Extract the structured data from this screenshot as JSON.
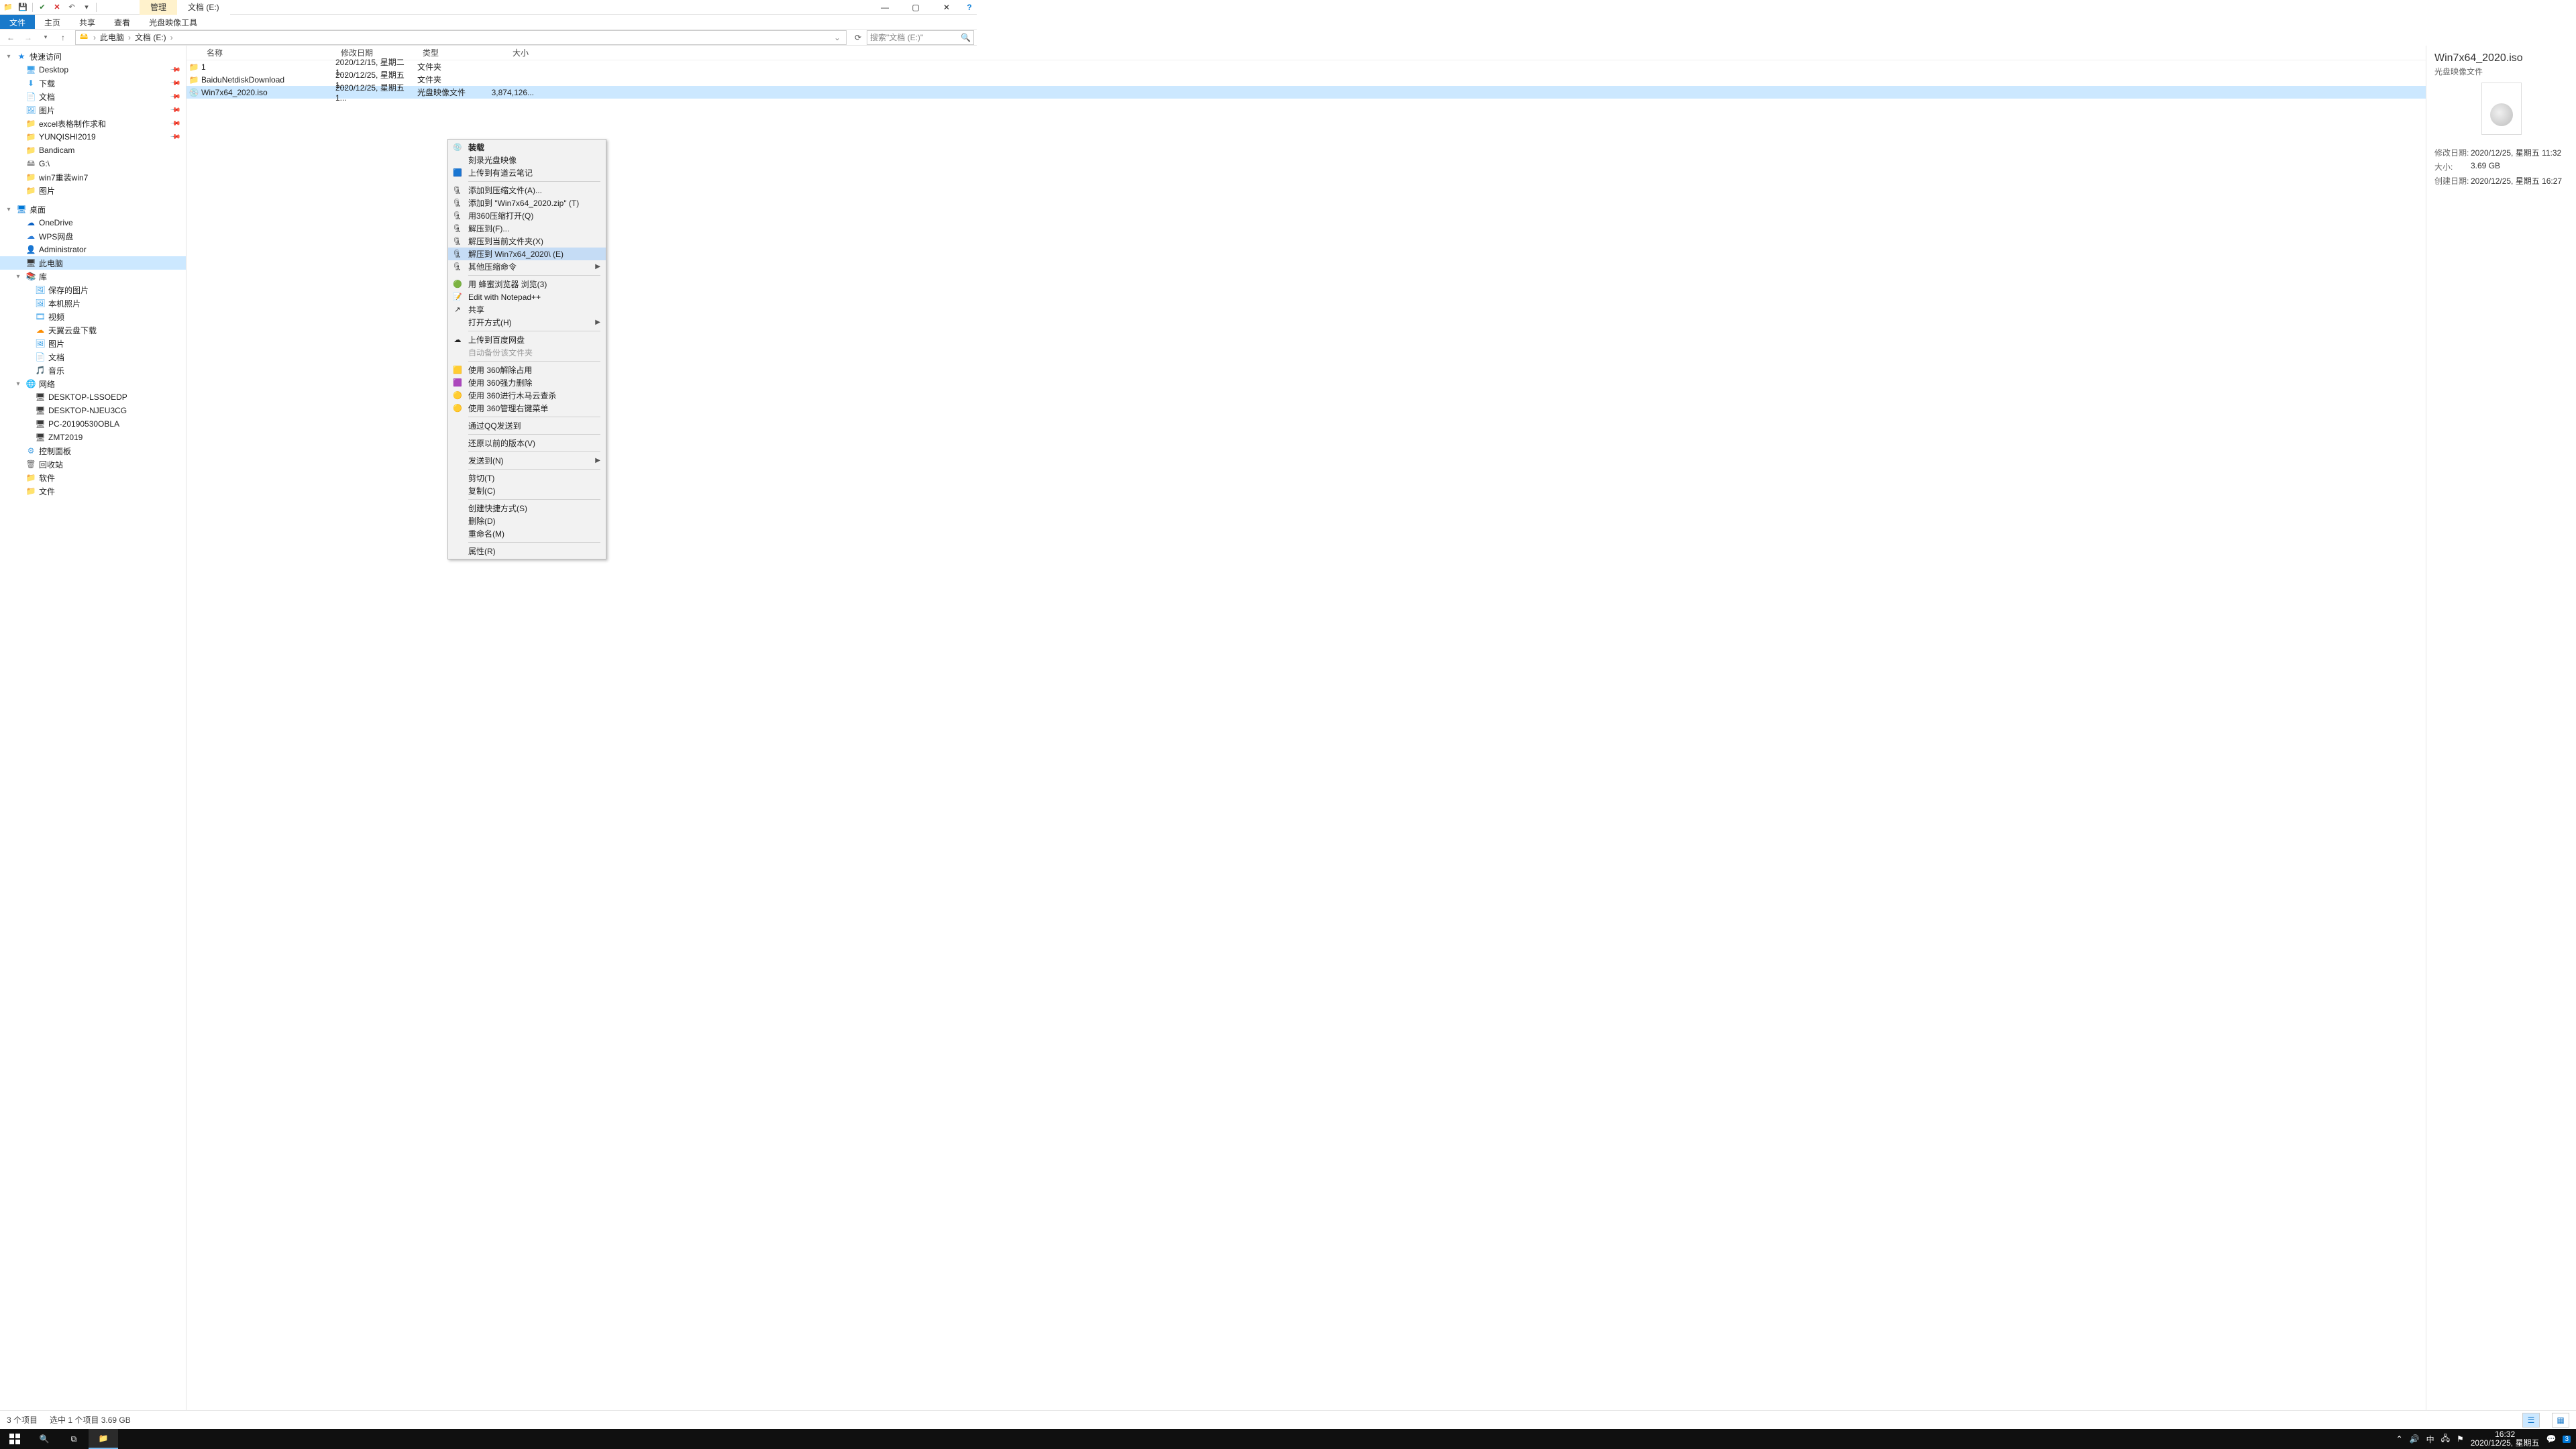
{
  "window": {
    "title_tab_highlight": "管理",
    "title_tab_plain": "文档 (E:)"
  },
  "ribbon": {
    "file": "文件",
    "home": "主页",
    "share": "共享",
    "view": "查看",
    "disc_tools": "光盘映像工具"
  },
  "address": {
    "crumbs": [
      "此电脑",
      "文档 (E:)"
    ],
    "search_placeholder": "搜索\"文档 (E:)\""
  },
  "nav": {
    "groups": [
      {
        "indent": 0,
        "icon": "star",
        "color": "#1e88e5",
        "label": "快速访问",
        "exp": "▾"
      },
      {
        "indent": 1,
        "icon": "desktop",
        "color": "#3aa0e8",
        "label": "Desktop",
        "pin": true
      },
      {
        "indent": 1,
        "icon": "download",
        "color": "#3aa0e8",
        "label": "下载",
        "pin": true
      },
      {
        "indent": 1,
        "icon": "doc",
        "color": "#3aa0e8",
        "label": "文档",
        "pin": true
      },
      {
        "indent": 1,
        "icon": "pic",
        "color": "#3aa0e8",
        "label": "图片",
        "pin": true
      },
      {
        "indent": 1,
        "icon": "folder",
        "color": "#ffb900",
        "label": "excel表格制作求和",
        "pin": true
      },
      {
        "indent": 1,
        "icon": "folder",
        "color": "#ffb900",
        "label": "YUNQISHI2019",
        "pin": true
      },
      {
        "indent": 1,
        "icon": "folder",
        "color": "#ffb900",
        "label": "Bandicam"
      },
      {
        "indent": 1,
        "icon": "drive",
        "color": "#8a8a8a",
        "label": "G:\\"
      },
      {
        "indent": 1,
        "icon": "folder",
        "color": "#ffb900",
        "label": "win7重装win7"
      },
      {
        "indent": 1,
        "icon": "folder",
        "color": "#ffb900",
        "label": "图片"
      },
      {
        "indent": 0,
        "spacer": true
      },
      {
        "indent": 0,
        "icon": "desktop",
        "color": "#0078d7",
        "label": "桌面",
        "exp": "▾"
      },
      {
        "indent": 1,
        "icon": "cloud",
        "color": "#0b61c4",
        "label": "OneDrive"
      },
      {
        "indent": 1,
        "icon": "cloud",
        "color": "#2e7dd7",
        "label": "WPS网盘"
      },
      {
        "indent": 1,
        "icon": "user",
        "color": "#7cb342",
        "label": "Administrator"
      },
      {
        "indent": 1,
        "icon": "pc",
        "color": "#3a3a3a",
        "label": "此电脑",
        "selected": true
      },
      {
        "indent": 1,
        "icon": "lib",
        "color": "#7aa7d8",
        "label": "库",
        "exp": "▾"
      },
      {
        "indent": 2,
        "icon": "pic",
        "color": "#3aa0e8",
        "label": "保存的图片"
      },
      {
        "indent": 2,
        "icon": "pic",
        "color": "#3aa0e8",
        "label": "本机照片"
      },
      {
        "indent": 2,
        "icon": "video",
        "color": "#3aa0e8",
        "label": "视频"
      },
      {
        "indent": 2,
        "icon": "cloud",
        "color": "#fb8c00",
        "label": "天翼云盘下载"
      },
      {
        "indent": 2,
        "icon": "pic",
        "color": "#3aa0e8",
        "label": "图片"
      },
      {
        "indent": 2,
        "icon": "doc",
        "color": "#3aa0e8",
        "label": "文档"
      },
      {
        "indent": 2,
        "icon": "music",
        "color": "#3aa0e8",
        "label": "音乐"
      },
      {
        "indent": 1,
        "icon": "net",
        "color": "#3aa0e8",
        "label": "网络",
        "exp": "▾"
      },
      {
        "indent": 2,
        "icon": "pc",
        "color": "#3a3a3a",
        "label": "DESKTOP-LSSOEDP"
      },
      {
        "indent": 2,
        "icon": "pc",
        "color": "#3a3a3a",
        "label": "DESKTOP-NJEU3CG"
      },
      {
        "indent": 2,
        "icon": "pc",
        "color": "#3a3a3a",
        "label": "PC-20190530OBLA"
      },
      {
        "indent": 2,
        "icon": "pc",
        "color": "#3a3a3a",
        "label": "ZMT2019"
      },
      {
        "indent": 1,
        "icon": "panel",
        "color": "#4ba3e3",
        "label": "控制面板"
      },
      {
        "indent": 1,
        "icon": "bin",
        "color": "#6d6d6d",
        "label": "回收站"
      },
      {
        "indent": 1,
        "icon": "folder",
        "color": "#ffb900",
        "label": "软件"
      },
      {
        "indent": 1,
        "icon": "folder",
        "color": "#ffb900",
        "label": "文件"
      }
    ]
  },
  "columns": {
    "name": "名称",
    "date": "修改日期",
    "type": "类型",
    "size": "大小"
  },
  "files": [
    {
      "icon": "folder",
      "name": "1",
      "date": "2020/12/15, 星期二 1...",
      "type": "文件夹",
      "size": ""
    },
    {
      "icon": "folder",
      "name": "BaiduNetdiskDownload",
      "date": "2020/12/25, 星期五 1...",
      "type": "文件夹",
      "size": ""
    },
    {
      "icon": "iso",
      "name": "Win7x64_2020.iso",
      "date": "2020/12/25, 星期五 1...",
      "type": "光盘映像文件",
      "size": "3,874,126...",
      "selected": true
    }
  ],
  "context_menu": [
    {
      "type": "item",
      "label": "装载",
      "icon": "disc",
      "bold": true
    },
    {
      "type": "item",
      "label": "刻录光盘映像"
    },
    {
      "type": "item",
      "label": "上传到有道云笔记",
      "icon": "blue"
    },
    {
      "type": "sep"
    },
    {
      "type": "item",
      "label": "添加到压缩文件(A)...",
      "icon": "zip"
    },
    {
      "type": "item",
      "label": "添加到 \"Win7x64_2020.zip\" (T)",
      "icon": "zip"
    },
    {
      "type": "item",
      "label": "用360压缩打开(Q)",
      "icon": "zip"
    },
    {
      "type": "item",
      "label": "解压到(F)...",
      "icon": "zip"
    },
    {
      "type": "item",
      "label": "解压到当前文件夹(X)",
      "icon": "zip"
    },
    {
      "type": "item",
      "label": "解压到 Win7x64_2020\\ (E)",
      "icon": "zip",
      "hover": true
    },
    {
      "type": "item",
      "label": "其他压缩命令",
      "icon": "zip",
      "arrow": true
    },
    {
      "type": "sep"
    },
    {
      "type": "item",
      "label": "用 蜂蜜浏览器 浏览(3)",
      "icon": "green"
    },
    {
      "type": "item",
      "label": "Edit with Notepad++",
      "icon": "npp"
    },
    {
      "type": "item",
      "label": "共享",
      "icon": "share"
    },
    {
      "type": "item",
      "label": "打开方式(H)",
      "arrow": true
    },
    {
      "type": "sep"
    },
    {
      "type": "item",
      "label": "上传到百度网盘",
      "icon": "baidu"
    },
    {
      "type": "item",
      "label": "自动备份该文件夹",
      "disabled": true
    },
    {
      "type": "sep"
    },
    {
      "type": "item",
      "label": "使用 360解除占用",
      "icon": "y360"
    },
    {
      "type": "item",
      "label": "使用 360强力删除",
      "icon": "p360"
    },
    {
      "type": "item",
      "label": "使用 360进行木马云查杀",
      "icon": "g360"
    },
    {
      "type": "item",
      "label": "使用 360管理右键菜单",
      "icon": "g360"
    },
    {
      "type": "sep"
    },
    {
      "type": "item",
      "label": "通过QQ发送到"
    },
    {
      "type": "sep"
    },
    {
      "type": "item",
      "label": "还原以前的版本(V)"
    },
    {
      "type": "sep"
    },
    {
      "type": "item",
      "label": "发送到(N)",
      "arrow": true
    },
    {
      "type": "sep"
    },
    {
      "type": "item",
      "label": "剪切(T)"
    },
    {
      "type": "item",
      "label": "复制(C)"
    },
    {
      "type": "sep"
    },
    {
      "type": "item",
      "label": "创建快捷方式(S)"
    },
    {
      "type": "item",
      "label": "删除(D)"
    },
    {
      "type": "item",
      "label": "重命名(M)"
    },
    {
      "type": "sep"
    },
    {
      "type": "item",
      "label": "属性(R)"
    }
  ],
  "details": {
    "title": "Win7x64_2020.iso",
    "subtitle": "光盘映像文件",
    "meta": [
      {
        "label": "修改日期:",
        "value": "2020/12/25, 星期五 11:32"
      },
      {
        "label": "大小:",
        "value": "3.69 GB"
      },
      {
        "label": "创建日期:",
        "value": "2020/12/25, 星期五 16:27"
      }
    ]
  },
  "status": {
    "items": "3 个项目",
    "selected": "选中 1 个项目  3.69 GB"
  },
  "taskbar": {
    "time": "16:32",
    "date": "2020/12/25, 星期五",
    "ime": "中",
    "badge": "3"
  }
}
